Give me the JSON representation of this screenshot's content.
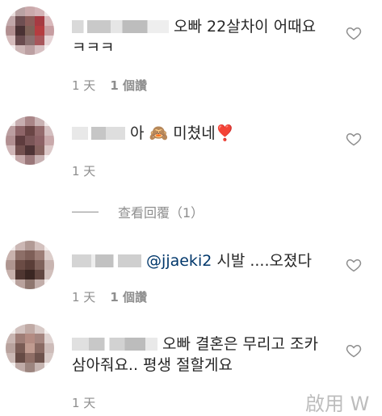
{
  "comments": [
    {
      "text": "오빠 22살차이 어때요 ㅋㅋㅋ",
      "time": "1 天",
      "likes": "1 個讚"
    },
    {
      "text": "아 🙈 미쳤네❣️",
      "time": "1 天",
      "likes": ""
    },
    {
      "mention": "@jjaeki2",
      "text": " 시발 ....오졌다",
      "time": "1 天",
      "likes": "1 個讚"
    },
    {
      "text": "오빠 결혼은 무리고 조카삼아줘요.. 평생 절할게요",
      "time": "1 天",
      "likes": ""
    }
  ],
  "view_replies": "查看回覆（1）",
  "watermark": "啟用 W",
  "icons": {
    "like": "heart-outline-icon"
  },
  "colors": {
    "text": "#262626",
    "secondary": "#8e8e8e",
    "mention": "#00376b"
  }
}
